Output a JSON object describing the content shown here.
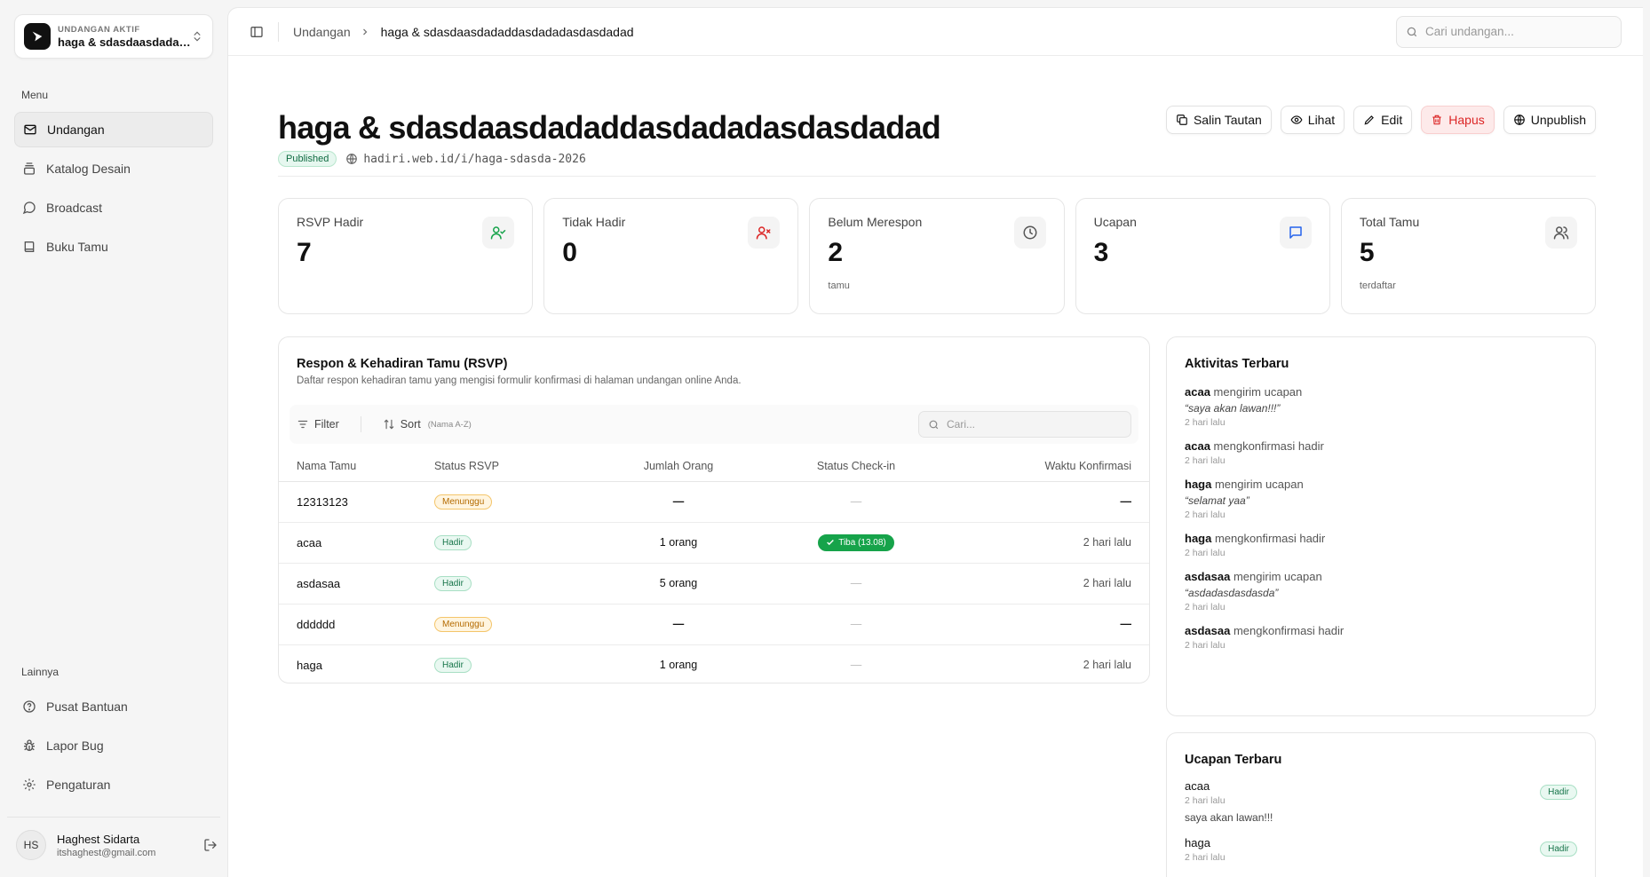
{
  "sidebar": {
    "switcher_caption": "UNDANGAN AKTIF",
    "switcher_name": "haga & sdasdaasdadaddasdadadasdasdadad",
    "menu_label": "Menu",
    "items": [
      {
        "label": "Undangan",
        "icon": "mail-icon"
      },
      {
        "label": "Katalog Desain",
        "icon": "catalog-icon"
      },
      {
        "label": "Broadcast",
        "icon": "chat-icon"
      },
      {
        "label": "Buku Tamu",
        "icon": "book-icon"
      }
    ],
    "other_label": "Lainnya",
    "other_items": [
      {
        "label": "Pusat Bantuan",
        "icon": "help-icon"
      },
      {
        "label": "Lapor Bug",
        "icon": "bug-icon"
      },
      {
        "label": "Pengaturan",
        "icon": "gear-icon"
      }
    ],
    "user": {
      "initials": "HS",
      "name": "Haghest Sidarta",
      "email": "itshaghest@gmail.com"
    }
  },
  "topbar": {
    "breadcrumb_root": "Undangan",
    "breadcrumb_current": "haga & sdasdaasdadaddasdadadasdasdadad",
    "search_placeholder": "Cari undangan..."
  },
  "page": {
    "title": "haga & sdasdaasdadaddasdadadasdasdadad",
    "status": "Published",
    "url": "hadiri.web.id/i/haga-sdasda-2026",
    "actions": {
      "copy": "Salin Tautan",
      "view": "Lihat",
      "edit": "Edit",
      "delete": "Hapus",
      "unpublish": "Unpublish"
    }
  },
  "stats": [
    {
      "label": "RSVP Hadir",
      "value": "7",
      "sub": "",
      "icon": "user-check-icon",
      "color": "#16a34a"
    },
    {
      "label": "Tidak Hadir",
      "value": "0",
      "sub": "",
      "icon": "user-x-icon",
      "color": "#dc2626"
    },
    {
      "label": "Belum Merespon",
      "value": "2",
      "sub": "tamu",
      "icon": "clock-icon",
      "color": "#555555"
    },
    {
      "label": "Ucapan",
      "value": "3",
      "sub": "",
      "icon": "message-icon",
      "color": "#2563eb"
    },
    {
      "label": "Total Tamu",
      "value": "5",
      "sub": "terdaftar",
      "icon": "users-icon",
      "color": "#555555"
    }
  ],
  "rsvp": {
    "title": "Respon & Kehadiran Tamu (RSVP)",
    "description": "Daftar respon kehadiran tamu yang mengisi formulir konfirmasi di halaman undangan online Anda.",
    "filter_label": "Filter",
    "sort_label": "Sort",
    "sort_hint": "(Nama A-Z)",
    "search_placeholder": "Cari...",
    "columns": [
      "Nama Tamu",
      "Status RSVP",
      "Jumlah Orang",
      "Status Check-in",
      "Waktu Konfirmasi"
    ],
    "rows": [
      {
        "name": "12313123",
        "status": "Menunggu",
        "people": "—",
        "checkin": "—",
        "time": "—"
      },
      {
        "name": "acaa",
        "status": "Hadir",
        "people": "1 orang",
        "checkin": "Tiba (13.08)",
        "time": "2 hari lalu"
      },
      {
        "name": "asdasaa",
        "status": "Hadir",
        "people": "5 orang",
        "checkin": "—",
        "time": "2 hari lalu"
      },
      {
        "name": "dddddd",
        "status": "Menunggu",
        "people": "—",
        "checkin": "—",
        "time": "—"
      },
      {
        "name": "haga",
        "status": "Hadir",
        "people": "1 orang",
        "checkin": "—",
        "time": "2 hari lalu"
      }
    ]
  },
  "activity": {
    "title": "Aktivitas Terbaru",
    "items": [
      {
        "actor": "acaa",
        "action": "mengirim ucapan",
        "quote": "“saya akan lawan!!!”",
        "time": "2 hari lalu"
      },
      {
        "actor": "acaa",
        "action": "mengkonfirmasi hadir",
        "quote": "",
        "time": "2 hari lalu"
      },
      {
        "actor": "haga",
        "action": "mengirim ucapan",
        "quote": "“selamat yaa”",
        "time": "2 hari lalu"
      },
      {
        "actor": "haga",
        "action": "mengkonfirmasi hadir",
        "quote": "",
        "time": "2 hari lalu"
      },
      {
        "actor": "asdasaa",
        "action": "mengirim ucapan",
        "quote": "“asdadasdasdasda”",
        "time": "2 hari lalu"
      },
      {
        "actor": "asdasaa",
        "action": "mengkonfirmasi hadir",
        "quote": "",
        "time": "2 hari lalu"
      }
    ]
  },
  "greetings": {
    "title": "Ucapan Terbaru",
    "items": [
      {
        "name": "acaa",
        "time": "2 hari lalu",
        "message": "saya akan lawan!!!",
        "badge": "Hadir"
      },
      {
        "name": "haga",
        "time": "2 hari lalu",
        "message": "",
        "badge": "Hadir"
      }
    ]
  }
}
